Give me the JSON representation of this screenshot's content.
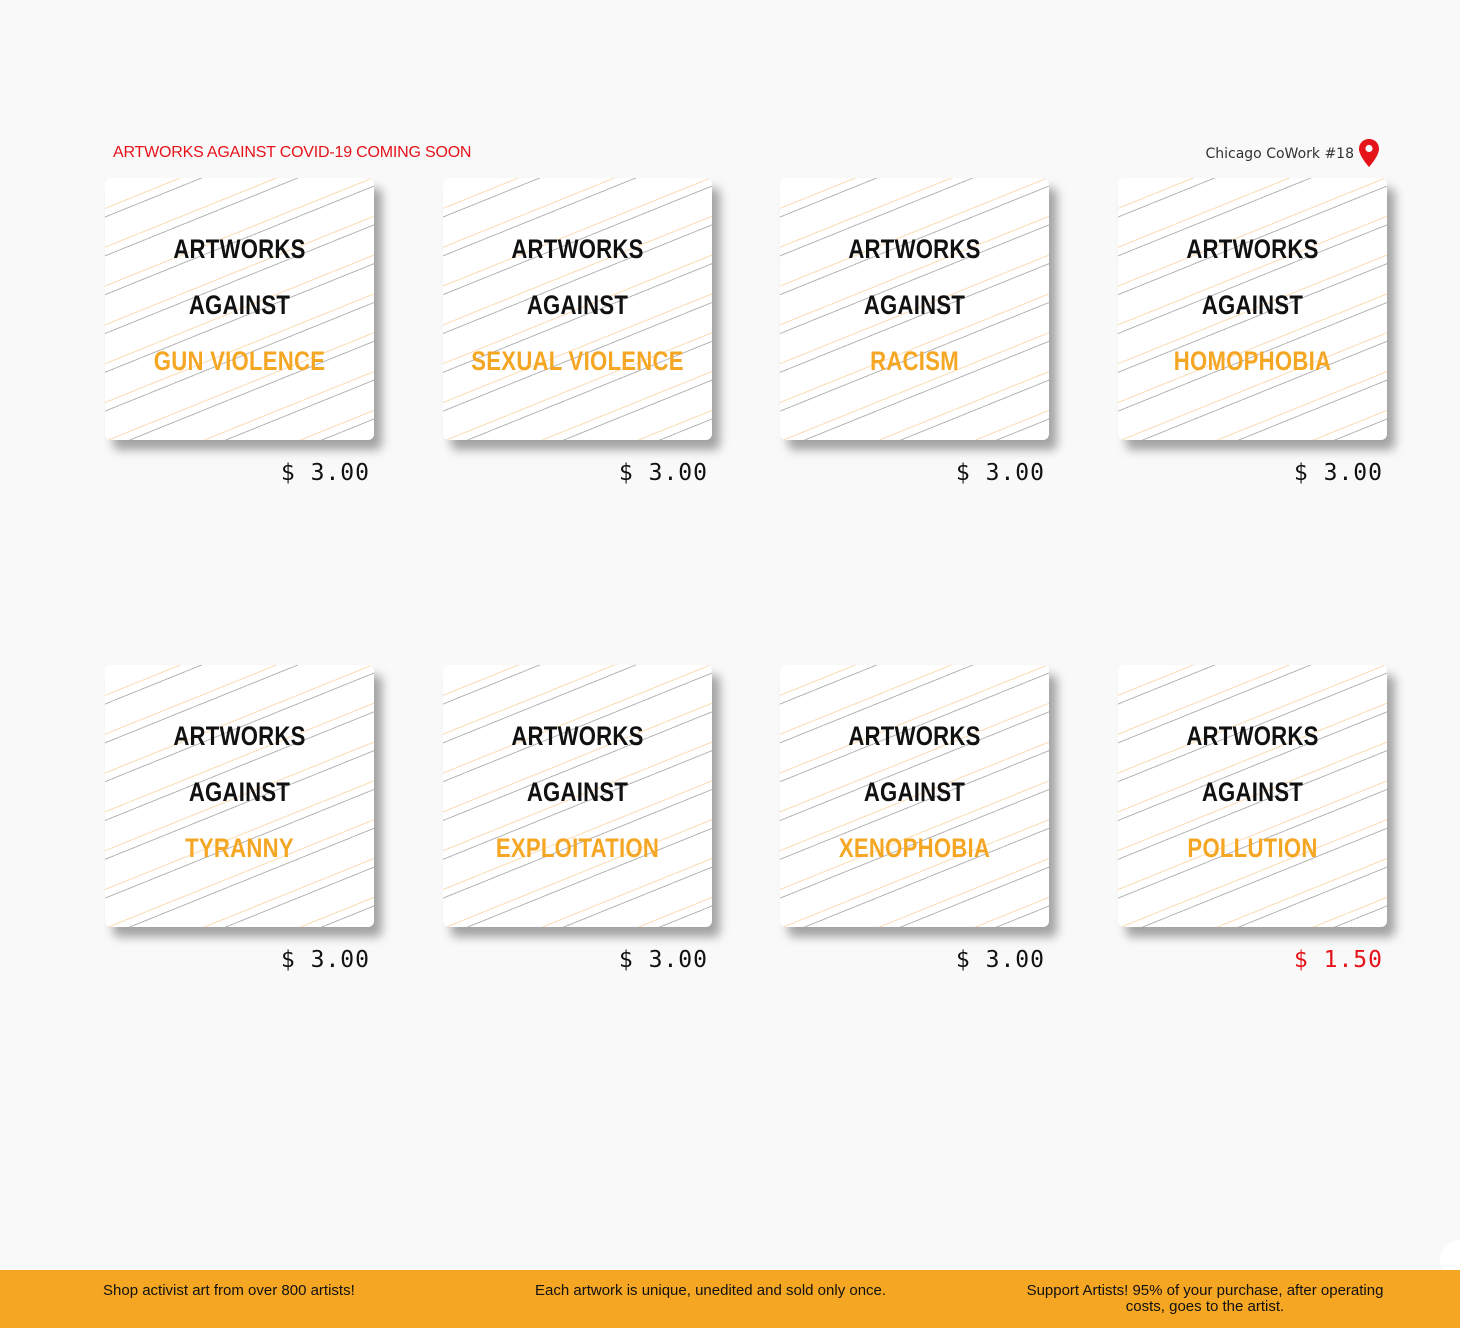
{
  "header": {
    "banner": "ARTWORKS AGAINST COVID-19 COMING SOON",
    "location": "Chicago CoWork #18",
    "location_icon": "map-pin-icon",
    "banner_color": "#e5131a"
  },
  "products": [
    {
      "line1": "ARTWORKS",
      "line2": "AGAINST",
      "line3": "GUN VIOLENCE",
      "price": "$ 3.00",
      "sale": false
    },
    {
      "line1": "ARTWORKS",
      "line2": "AGAINST",
      "line3": "SEXUAL VIOLENCE",
      "price": "$ 3.00",
      "sale": false
    },
    {
      "line1": "ARTWORKS",
      "line2": "AGAINST",
      "line3": "RACISM",
      "price": "$ 3.00",
      "sale": false
    },
    {
      "line1": "ARTWORKS",
      "line2": "AGAINST",
      "line3": "HOMOPHOBIA",
      "price": "$ 3.00",
      "sale": false
    },
    {
      "line1": "ARTWORKS",
      "line2": "AGAINST",
      "line3": "TYRANNY",
      "price": "$ 3.00",
      "sale": false
    },
    {
      "line1": "ARTWORKS",
      "line2": "AGAINST",
      "line3": "EXPLOITATION",
      "price": "$ 3.00",
      "sale": false
    },
    {
      "line1": "ARTWORKS",
      "line2": "AGAINST",
      "line3": "XENOPHOBIA",
      "price": "$ 3.00",
      "sale": false
    },
    {
      "line1": "ARTWORKS",
      "line2": "AGAINST",
      "line3": "POLLUTION",
      "price": "$ 1.50",
      "sale": true
    }
  ],
  "footer": {
    "item1": "Shop activist art from over 800 artists!",
    "item2": "Each artwork is unique, unedited and sold only once.",
    "item3": "Support Artists! 95% of your purchase, after operating costs, goes to the artist.",
    "background_color": "#f5a623"
  },
  "colors": {
    "accent": "#f5a623",
    "sale": "#e5131a"
  }
}
